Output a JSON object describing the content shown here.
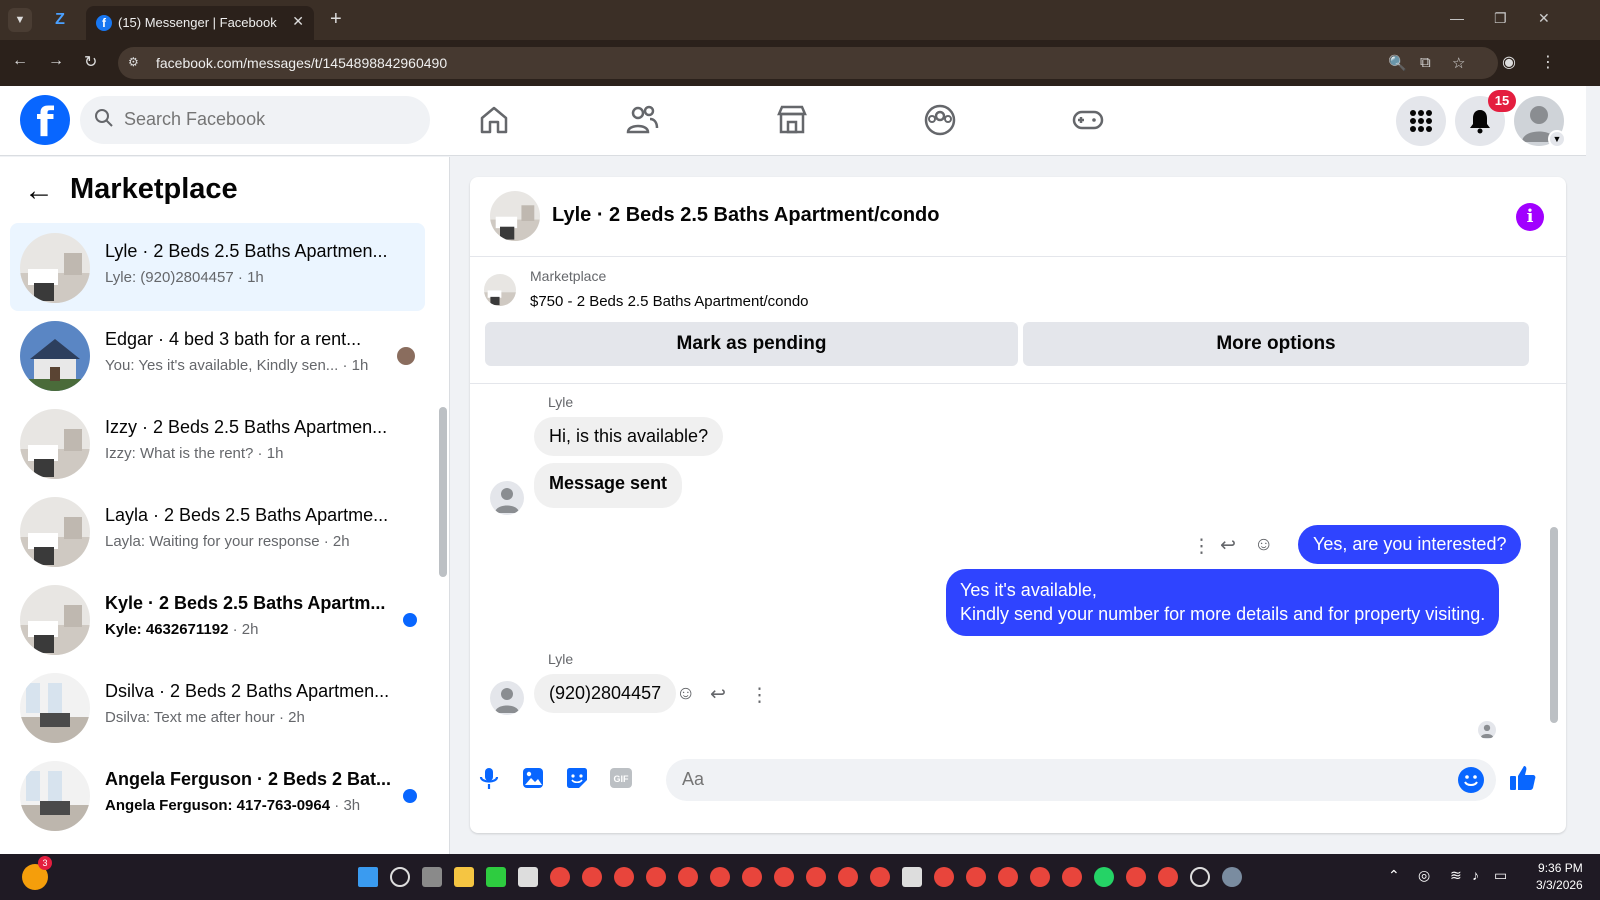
{
  "browser": {
    "tab_title": "(15) Messenger | Facebook",
    "url": "facebook.com/messages/t/1454898842960490"
  },
  "header": {
    "search_placeholder": "Search Facebook",
    "notifications_count": "15",
    "brand_color": "#0866ff"
  },
  "sidebar": {
    "title": "Marketplace",
    "conversations": [
      {
        "name": "Lyle · 2 Beds 2.5 Baths Apartmen...",
        "snippet": "Lyle: (920)2804457",
        "time": "1h",
        "unread": false,
        "active": true
      },
      {
        "name": "Edgar · 4 bed 3 bath for a rent...",
        "snippet": "You: Yes it's available, Kindly sen...",
        "time": "1h",
        "unread": false,
        "active": false
      },
      {
        "name": "Izzy · 2 Beds 2.5 Baths Apartmen...",
        "snippet": "Izzy: What is the rent?",
        "time": "1h",
        "unread": false,
        "active": false
      },
      {
        "name": "Layla · 2 Beds 2.5 Baths Apartme...",
        "snippet": "Layla: Waiting for your response",
        "time": "2h",
        "unread": false,
        "active": false
      },
      {
        "name": "Kyle · 2 Beds 2.5 Baths Apartm...",
        "snippet": "Kyle: 4632671192",
        "time": "2h",
        "unread": true,
        "active": false
      },
      {
        "name": "Dsilva · 2 Beds 2 Baths Apartmen...",
        "snippet": "Dsilva: Text me after hour",
        "time": "2h",
        "unread": false,
        "active": false
      },
      {
        "name": "Angela Ferguson · 2 Beds 2 Bat...",
        "snippet": "Angela Ferguson: 417-763-0964",
        "time": "3h",
        "unread": true,
        "active": false
      }
    ]
  },
  "chat": {
    "title": "Lyle · 2 Beds 2.5 Baths Apartment/condo",
    "listing": {
      "source": "Marketplace",
      "price_title": "$750 - 2 Beds 2.5 Baths Apartment/condo"
    },
    "buttons": {
      "pending": "Mark as pending",
      "more": "More options"
    },
    "messages": {
      "sender1": "Lyle",
      "in1": "Hi, is this available?",
      "in2": "Message sent",
      "out1": "Yes, are you interested?",
      "out2_line1": "Yes it's available,",
      "out2_line2": "Kindly send your number for more details and for property visiting.",
      "sender2": "Lyle",
      "in3": "(920)2804457"
    },
    "composer_placeholder": "Aa",
    "outgoing_color": "#2f44ff"
  },
  "taskbar": {
    "time": "9:36 PM",
    "date": "3/3/2026",
    "weather_badge": "3"
  }
}
